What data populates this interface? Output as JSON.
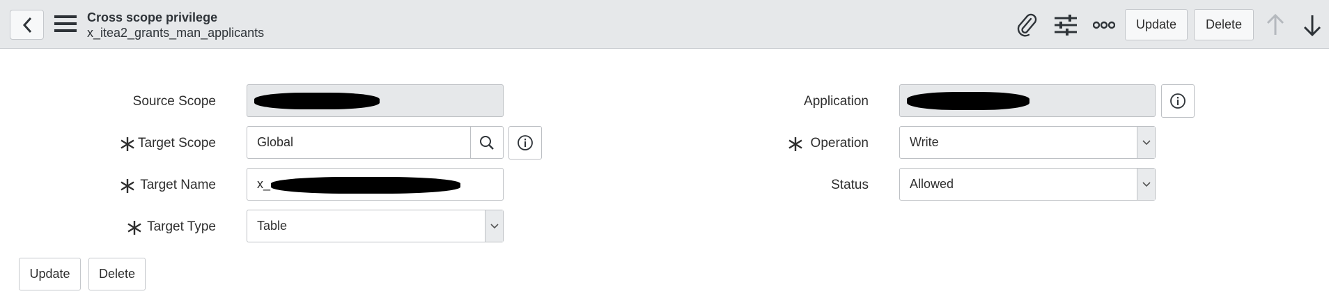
{
  "header": {
    "title": "Cross scope privilege",
    "subtitle": "x_itea2_grants_man_applicants",
    "update_label": "Update",
    "delete_label": "Delete"
  },
  "form": {
    "source_scope": {
      "label": "Source Scope",
      "value": ""
    },
    "target_scope": {
      "label": "Target Scope",
      "value": "Global"
    },
    "target_name": {
      "label": "Target Name",
      "value": "x_"
    },
    "target_type": {
      "label": "Target Type",
      "value": "Table"
    },
    "application": {
      "label": "Application",
      "value": ""
    },
    "operation": {
      "label": "Operation",
      "value": "Write"
    },
    "status": {
      "label": "Status",
      "value": "Allowed"
    }
  },
  "footer": {
    "update_label": "Update",
    "delete_label": "Delete"
  },
  "colors": {
    "header_bg": "#e6e8ea",
    "readonly_bg": "#e6e8ea",
    "disabled_arrow": "#b5b9be"
  }
}
